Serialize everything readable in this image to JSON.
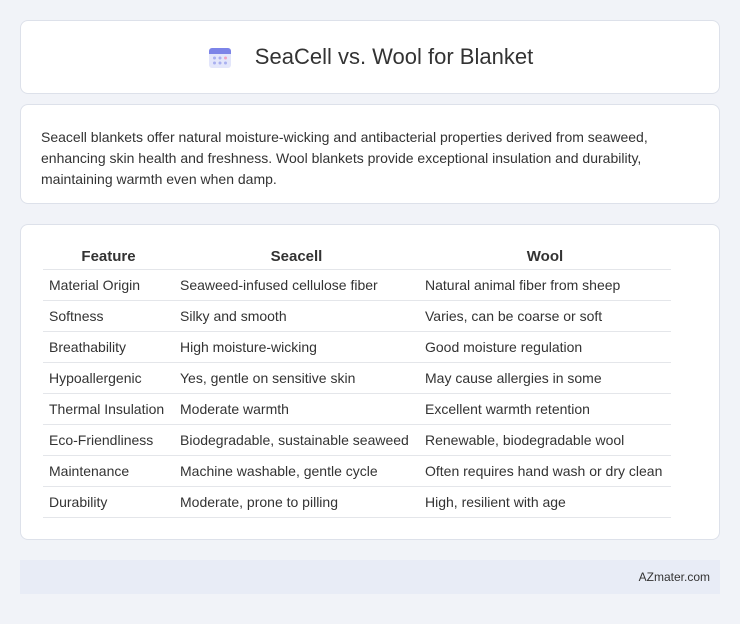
{
  "header": {
    "title": "SeaCell vs. Wool for Blanket",
    "icon": "calendar-icon"
  },
  "description": "Seacell blankets offer natural moisture-wicking and antibacterial properties derived from seaweed, enhancing skin health and freshness. Wool blankets provide exceptional insulation and durability, maintaining warmth even when damp.",
  "table": {
    "headers": [
      "Feature",
      "Seacell",
      "Wool"
    ],
    "rows": [
      [
        "Material Origin",
        "Seaweed-infused cellulose fiber",
        "Natural animal fiber from sheep"
      ],
      [
        "Softness",
        "Silky and smooth",
        "Varies, can be coarse or soft"
      ],
      [
        "Breathability",
        "High moisture-wicking",
        "Good moisture regulation"
      ],
      [
        "Hypoallergenic",
        "Yes, gentle on sensitive skin",
        "May cause allergies in some"
      ],
      [
        "Thermal Insulation",
        "Moderate warmth",
        "Excellent warmth retention"
      ],
      [
        "Eco-Friendliness",
        "Biodegradable, sustainable seaweed",
        "Renewable, biodegradable wool"
      ],
      [
        "Maintenance",
        "Machine washable, gentle cycle",
        "Often requires hand wash or dry clean"
      ],
      [
        "Durability",
        "Moderate, prone to pilling",
        "High, resilient with age"
      ]
    ]
  },
  "footer": {
    "brand": "AZmater.com"
  }
}
